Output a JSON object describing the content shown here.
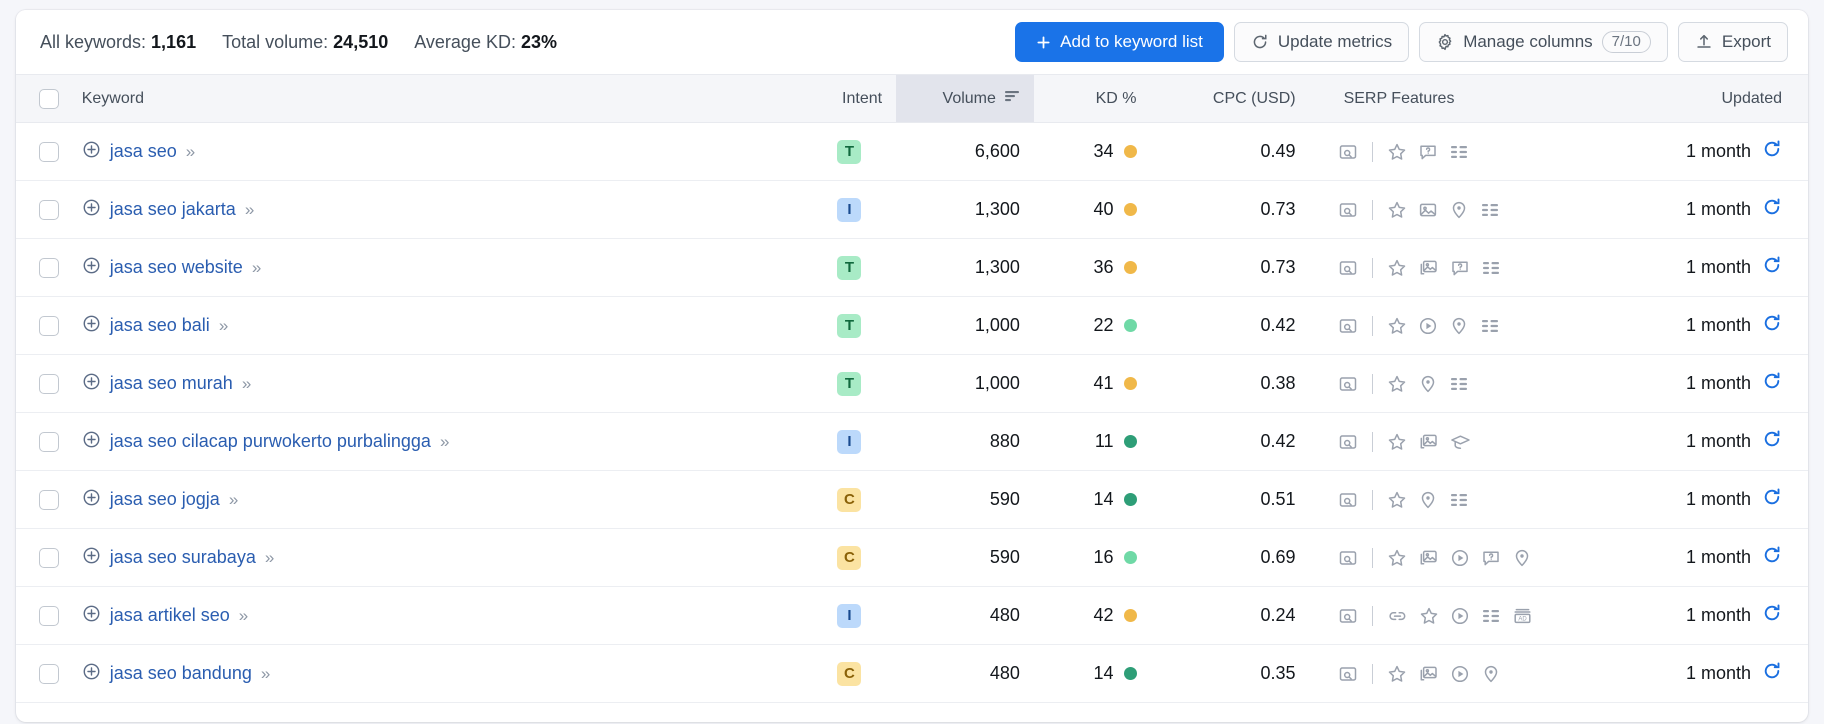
{
  "summary": {
    "all_keywords_label": "All keywords:",
    "all_keywords_value": "1,161",
    "total_volume_label": "Total volume:",
    "total_volume_value": "24,510",
    "average_kd_label": "Average KD:",
    "average_kd_value": "23%"
  },
  "toolbar": {
    "add_to_list": "Add to keyword list",
    "update_metrics": "Update metrics",
    "manage_columns": "Manage columns",
    "manage_columns_badge": "7/10",
    "export": "Export"
  },
  "table": {
    "headers": {
      "keyword": "Keyword",
      "intent": "Intent",
      "volume": "Volume",
      "kd": "KD %",
      "cpc": "CPC (USD)",
      "serp": "SERP Features",
      "updated": "Updated"
    },
    "sorted_column": "Volume",
    "rows": [
      {
        "keyword": "jasa seo",
        "intent": "T",
        "volume": "6,600",
        "kd": "34",
        "kd_color": "#f0b849",
        "cpc": "0.49",
        "serp": [
          "search-preview-icon",
          "divider",
          "star-icon",
          "faq-icon",
          "list-icon"
        ],
        "updated": "1 month"
      },
      {
        "keyword": "jasa seo jakarta",
        "intent": "I",
        "volume": "1,300",
        "kd": "40",
        "kd_color": "#f0b849",
        "cpc": "0.73",
        "serp": [
          "search-preview-icon",
          "divider",
          "star-icon",
          "image-icon",
          "location-icon",
          "list-icon"
        ],
        "updated": "1 month"
      },
      {
        "keyword": "jasa seo website",
        "intent": "T",
        "volume": "1,300",
        "kd": "36",
        "kd_color": "#f0b849",
        "cpc": "0.73",
        "serp": [
          "search-preview-icon",
          "divider",
          "star-icon",
          "image-stack-icon",
          "faq-icon",
          "list-icon"
        ],
        "updated": "1 month"
      },
      {
        "keyword": "jasa seo bali",
        "intent": "T",
        "volume": "1,000",
        "kd": "22",
        "kd_color": "#6fd9a6",
        "cpc": "0.42",
        "serp": [
          "search-preview-icon",
          "divider",
          "star-icon",
          "video-icon",
          "location-icon",
          "list-icon"
        ],
        "updated": "1 month"
      },
      {
        "keyword": "jasa seo murah",
        "intent": "T",
        "volume": "1,000",
        "kd": "41",
        "kd_color": "#f0b849",
        "cpc": "0.38",
        "serp": [
          "search-preview-icon",
          "divider",
          "star-icon",
          "location-icon",
          "list-icon"
        ],
        "updated": "1 month"
      },
      {
        "keyword": "jasa seo cilacap purwokerto purbalingga",
        "intent": "I",
        "volume": "880",
        "kd": "11",
        "kd_color": "#2e9e77",
        "cpc": "0.42",
        "serp": [
          "search-preview-icon",
          "divider",
          "star-icon",
          "image-stack-icon",
          "education-icon"
        ],
        "updated": "1 month"
      },
      {
        "keyword": "jasa seo jogja",
        "intent": "C",
        "volume": "590",
        "kd": "14",
        "kd_color": "#2e9e77",
        "cpc": "0.51",
        "serp": [
          "search-preview-icon",
          "divider",
          "star-icon",
          "location-icon",
          "list-icon"
        ],
        "updated": "1 month"
      },
      {
        "keyword": "jasa seo surabaya",
        "intent": "C",
        "volume": "590",
        "kd": "16",
        "kd_color": "#6fd9a6",
        "cpc": "0.69",
        "serp": [
          "search-preview-icon",
          "divider",
          "star-icon",
          "image-stack-icon",
          "video-icon",
          "faq-icon",
          "location-icon"
        ],
        "updated": "1 month"
      },
      {
        "keyword": "jasa artikel seo",
        "intent": "I",
        "volume": "480",
        "kd": "42",
        "kd_color": "#f0b849",
        "cpc": "0.24",
        "serp": [
          "search-preview-icon",
          "divider",
          "link-icon",
          "star-icon",
          "video-icon",
          "list-icon",
          "ad-icon"
        ],
        "updated": "1 month"
      },
      {
        "keyword": "jasa seo bandung",
        "intent": "C",
        "volume": "480",
        "kd": "14",
        "kd_color": "#2e9e77",
        "cpc": "0.35",
        "serp": [
          "search-preview-icon",
          "divider",
          "star-icon",
          "image-stack-icon",
          "video-icon",
          "location-icon"
        ],
        "updated": "1 month"
      }
    ]
  },
  "colors": {
    "accent": "#1a73e8",
    "link": "#2a5db0",
    "sorted_header": "#e2e4ec"
  }
}
